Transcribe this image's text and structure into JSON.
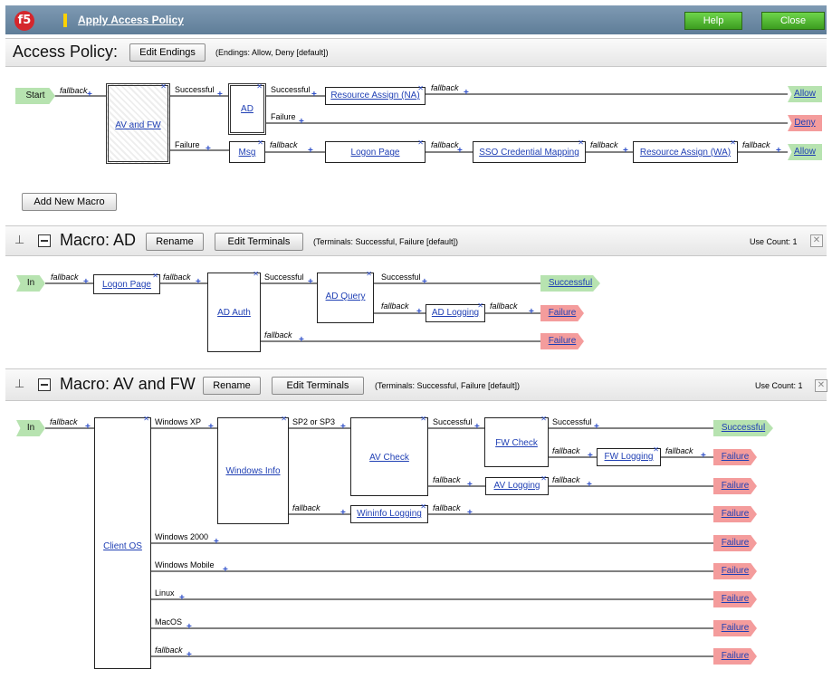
{
  "window": {
    "logo": "f5",
    "title": "Apply Access Policy",
    "help_label": "Help",
    "close_label": "Close"
  },
  "access_policy": {
    "title": "Access Policy:",
    "edit_endings_label": "Edit Endings",
    "endings_note": "(Endings: Allow, Deny [default])",
    "add_macro_label": "Add New Macro",
    "start_label": "Start",
    "nodes": {
      "av_and_fw": "AV and FW",
      "ad": "AD",
      "resource_assign_na": "Resource Assign (NA)",
      "msg": "Msg",
      "logon_page": "Logon Page",
      "sso": "SSO Credential Mapping",
      "resource_assign_wa": "Resource Assign (WA)"
    },
    "terminals": {
      "allow1": "Allow",
      "deny": "Deny",
      "allow2": "Allow"
    }
  },
  "macro_ad": {
    "title": "Macro: AD",
    "rename_label": "Rename",
    "edit_terminals_label": "Edit Terminals",
    "terminals_note": "(Terminals: Successful, Failure [default])",
    "use_count": "Use Count: 1",
    "in_label": "In",
    "nodes": {
      "logon_page": "Logon Page",
      "ad_auth": "AD Auth",
      "ad_query": "AD Query",
      "ad_logging": "AD Logging"
    },
    "terminals": {
      "successful": "Successful",
      "failure1": "Failure",
      "failure2": "Failure"
    }
  },
  "macro_avfw": {
    "title": "Macro: AV and FW",
    "rename_label": "Rename",
    "edit_terminals_label": "Edit Terminals",
    "terminals_note": "(Terminals: Successful, Failure [default])",
    "use_count": "Use Count: 1",
    "in_label": "In",
    "nodes": {
      "client_os": "Client OS",
      "windows_info": "Windows Info",
      "av_check": "AV Check",
      "fw_check": "FW Check",
      "fw_logging": "FW Logging",
      "av_logging": "AV Logging",
      "wininfo_logging": "Wininfo Logging"
    },
    "branches": {
      "windows_xp": "Windows XP",
      "windows_2000": "Windows 2000",
      "windows_mobile": "Windows Mobile",
      "linux": "Linux",
      "macos": "MacOS"
    },
    "terminals": {
      "successful": "Successful",
      "failure": "Failure"
    }
  },
  "edge_labels": {
    "fallback": "fallback",
    "successful": "Successful",
    "failure": "Failure",
    "sp2_sp3": "SP2 or SP3"
  },
  "colors": {
    "link": "#1f3fb4",
    "terminal_green": "#b7e3b0",
    "terminal_red": "#f49c9c",
    "header_buttons": "#3c9d20",
    "logo": "#d5262c"
  }
}
